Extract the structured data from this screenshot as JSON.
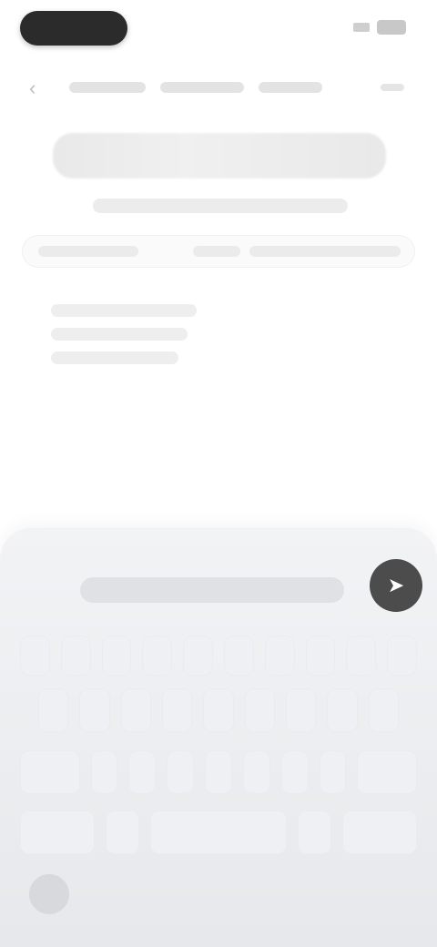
{
  "status_bar": {
    "left_pill": "",
    "icons": [
      "signal-icon",
      "battery-icon"
    ]
  },
  "topbar": {
    "back_icon": "back-icon",
    "breadcrumb": [
      "",
      "",
      ""
    ],
    "more_icon": "more-icon"
  },
  "page": {
    "title": "",
    "subtitle": ""
  },
  "table": {
    "headers": [
      "",
      "",
      ""
    ],
    "rows": [
      "",
      "",
      ""
    ]
  },
  "keyboard": {
    "suggestion": "",
    "send_label": "➤",
    "row1": [
      "",
      "",
      "",
      "",
      "",
      "",
      "",
      "",
      "",
      ""
    ],
    "row2": [
      "",
      "",
      "",
      "",
      "",
      "",
      "",
      "",
      ""
    ],
    "row3": [
      "",
      "",
      "",
      "",
      "",
      "",
      "",
      "",
      ""
    ],
    "row4": [
      "",
      "",
      "",
      "",
      ""
    ]
  },
  "colors": {
    "keyboard_bg": "#e6e8eb",
    "send_button": "#4c4c4c"
  }
}
